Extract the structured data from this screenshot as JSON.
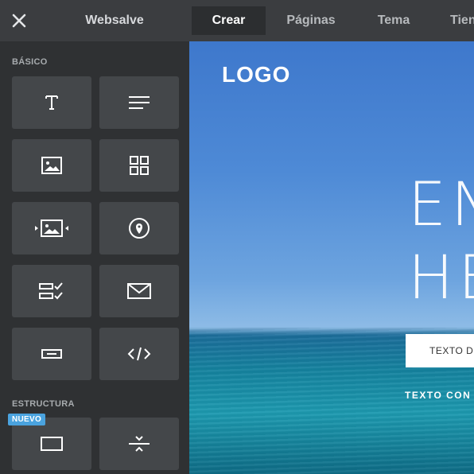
{
  "topbar": {
    "close_icon": "close-icon",
    "brand": "Websalve",
    "tabs": [
      {
        "label": "Crear",
        "active": true
      },
      {
        "label": "Páginas",
        "active": false
      },
      {
        "label": "Tema",
        "active": false
      },
      {
        "label": "Tien",
        "active": false
      }
    ]
  },
  "sidebar": {
    "sections": [
      {
        "title": "BÁSICO",
        "tiles": [
          {
            "icon": "text-icon"
          },
          {
            "icon": "paragraph-icon"
          },
          {
            "icon": "image-icon"
          },
          {
            "icon": "gallery-icon"
          },
          {
            "icon": "slideshow-icon"
          },
          {
            "icon": "map-pin-icon"
          },
          {
            "icon": "form-icon"
          },
          {
            "icon": "email-icon"
          },
          {
            "icon": "button-icon"
          },
          {
            "icon": "embed-code-icon"
          }
        ]
      },
      {
        "title": "ESTRUCTURA",
        "badge": "NUEVO",
        "tiles": [
          {
            "icon": "section-icon"
          },
          {
            "icon": "divider-icon"
          }
        ]
      }
    ]
  },
  "preview": {
    "logo": "LOGO",
    "hero_line1": "EN",
    "hero_line2": "HE",
    "cta_label": "TEXTO D",
    "subtext": "TEXTO CON"
  },
  "colors": {
    "sidebar_bg": "#2f3133",
    "tile_bg": "#44474a",
    "badge_bg": "#4aa3df",
    "topbar_bg": "#3b3d40"
  }
}
